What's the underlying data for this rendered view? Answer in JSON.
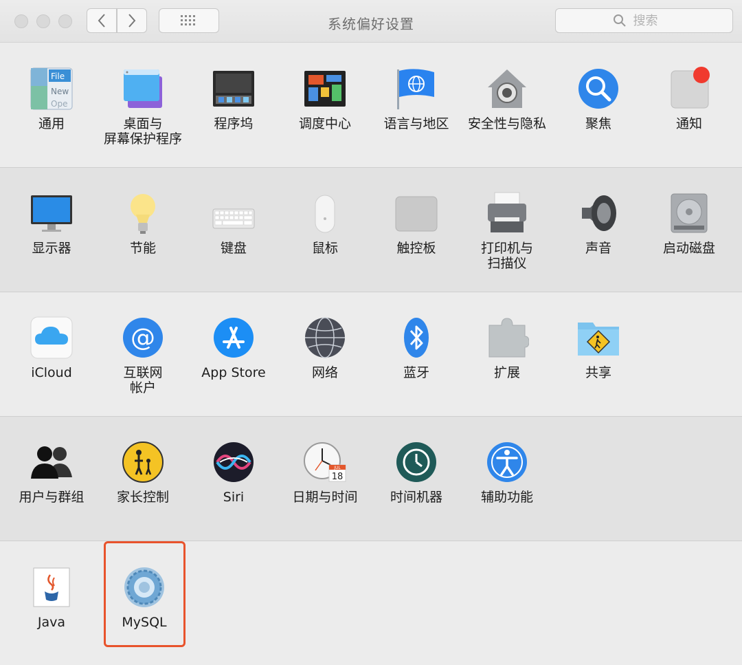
{
  "window": {
    "title": "系统偏好设置",
    "search_placeholder": "搜索"
  },
  "rows": [
    [
      {
        "id": "general",
        "label": "通用",
        "icon": "general-file-icon"
      },
      {
        "id": "desktop",
        "label": "桌面与\n屏幕保护程序",
        "icon": "desktop-screensaver-icon"
      },
      {
        "id": "dock",
        "label": "程序坞",
        "icon": "dock-icon"
      },
      {
        "id": "mission",
        "label": "调度中心",
        "icon": "mission-control-icon"
      },
      {
        "id": "language",
        "label": "语言与地区",
        "icon": "flag-globe-icon"
      },
      {
        "id": "security",
        "label": "安全性与隐私",
        "icon": "house-lock-icon"
      },
      {
        "id": "spotlight",
        "label": "聚焦",
        "icon": "magnifier-icon"
      },
      {
        "id": "notifications",
        "label": "通知",
        "icon": "notification-icon"
      }
    ],
    [
      {
        "id": "displays",
        "label": "显示器",
        "icon": "monitor-icon"
      },
      {
        "id": "energy",
        "label": "节能",
        "icon": "lightbulb-icon"
      },
      {
        "id": "keyboard",
        "label": "键盘",
        "icon": "keyboard-icon"
      },
      {
        "id": "mouse",
        "label": "鼠标",
        "icon": "mouse-icon"
      },
      {
        "id": "trackpad",
        "label": "触控板",
        "icon": "trackpad-icon"
      },
      {
        "id": "printers",
        "label": "打印机与\n扫描仪",
        "icon": "printer-icon"
      },
      {
        "id": "sound",
        "label": "声音",
        "icon": "speaker-icon"
      },
      {
        "id": "startup",
        "label": "启动磁盘",
        "icon": "hard-disk-icon"
      }
    ],
    [
      {
        "id": "icloud",
        "label": "iCloud",
        "icon": "cloud-icon"
      },
      {
        "id": "internet",
        "label": "互联网\n帐户",
        "icon": "at-sign-icon"
      },
      {
        "id": "appstore",
        "label": "App Store",
        "icon": "app-store-icon"
      },
      {
        "id": "network",
        "label": "网络",
        "icon": "globe-network-icon"
      },
      {
        "id": "bluetooth",
        "label": "蓝牙",
        "icon": "bluetooth-icon"
      },
      {
        "id": "extensions",
        "label": "扩展",
        "icon": "puzzle-icon"
      },
      {
        "id": "sharing",
        "label": "共享",
        "icon": "shared-folder-icon"
      }
    ],
    [
      {
        "id": "users",
        "label": "用户与群组",
        "icon": "users-icon"
      },
      {
        "id": "parental",
        "label": "家长控制",
        "icon": "parental-icon"
      },
      {
        "id": "siri",
        "label": "Siri",
        "icon": "siri-icon"
      },
      {
        "id": "datetime",
        "label": "日期与时间",
        "icon": "clock-calendar-icon"
      },
      {
        "id": "timemachine",
        "label": "时间机器",
        "icon": "time-machine-icon"
      },
      {
        "id": "accessibility",
        "label": "辅助功能",
        "icon": "accessibility-icon"
      }
    ],
    [
      {
        "id": "java",
        "label": "Java",
        "icon": "java-cup-icon"
      },
      {
        "id": "mysql",
        "label": "MySQL",
        "icon": "mysql-gear-icon"
      }
    ]
  ],
  "colors": {
    "highlight": "#e8532c",
    "notification_badge": "#f03a2e"
  }
}
